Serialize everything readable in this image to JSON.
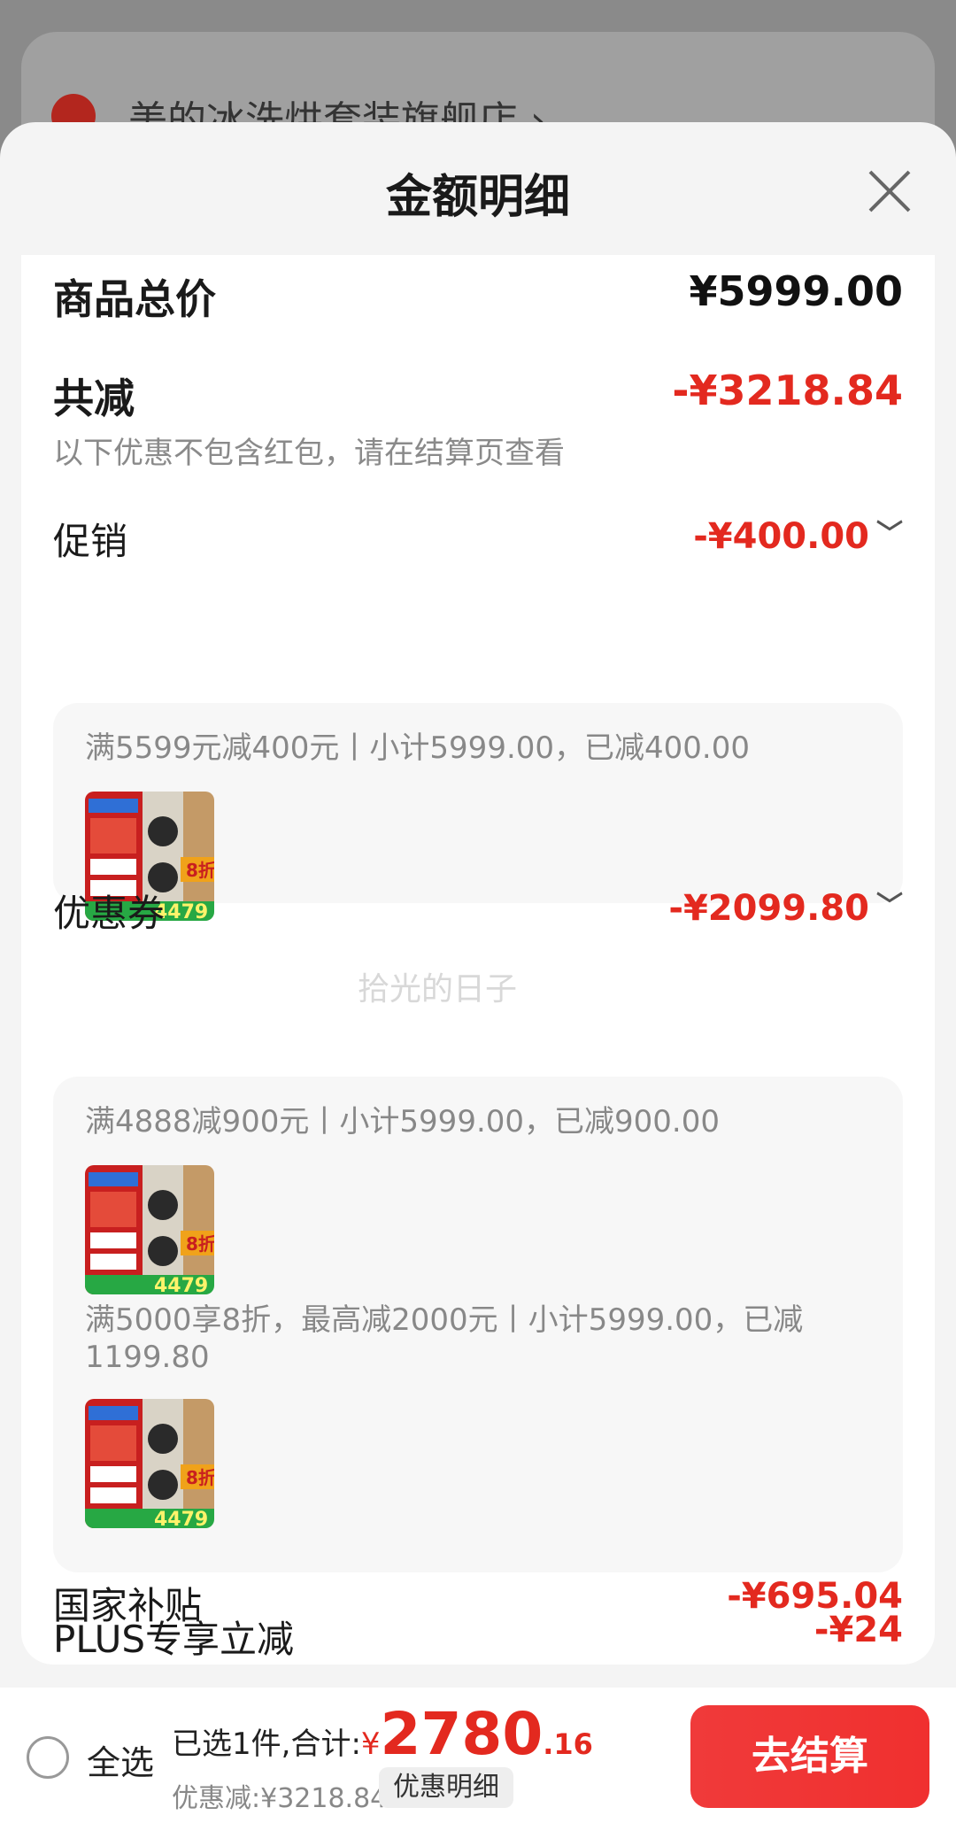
{
  "background": {
    "store_name": "美的冰洗烘套装旗舰店 ›"
  },
  "sheet": {
    "title": "金额明细"
  },
  "summary": {
    "total_label": "商品总价",
    "total_value": "¥5999.00",
    "reduce_label": "共减",
    "reduce_value": "-¥3218.84",
    "reduce_note": "以下优惠不包含红包，请在结算页查看"
  },
  "promotion": {
    "label": "促销",
    "value": "-¥400.00",
    "rule": "满5599元减400元丨小计5999.00，已减400.00"
  },
  "coupon": {
    "label": "优惠券",
    "value": "-¥2099.80",
    "rule1": "满4888减900元丨小计5999.00，已减900.00",
    "rule2_line1": "满5000享8折，最高减2000元丨小计5999.00，已减",
    "rule2_line2": "1199.80"
  },
  "plus": {
    "label": "PLUS专享立减",
    "value": "-¥24"
  },
  "subsidy": {
    "label": "国家补贴",
    "value": "-¥695.04"
  },
  "thumb": {
    "price": "4479",
    "badge": "8折"
  },
  "watermark": "拾光的日子",
  "bottom": {
    "select_all": "全选",
    "selected_prefix": "已选1件,合计:",
    "currency": "¥",
    "total_int": "2780",
    "total_dec": ".16",
    "saved": "优惠减:¥3218.84",
    "detail_link": "优惠明细",
    "checkout": "去结算"
  },
  "colors": {
    "accent": "#e3291f",
    "checkout": "#f03a3a"
  }
}
